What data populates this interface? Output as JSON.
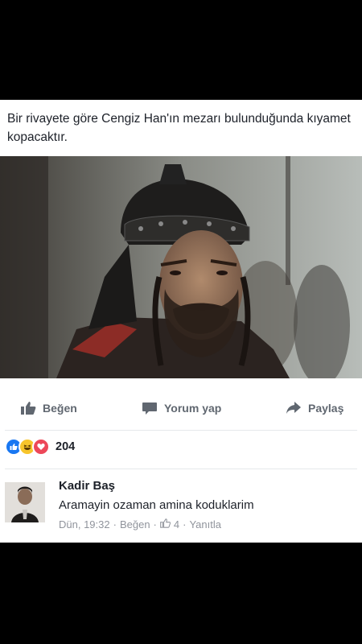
{
  "post": {
    "text": "Bir rivayete göre Cengiz Han'ın mezarı bulunduğunda kıyamet kopacaktır."
  },
  "actions": {
    "like_label": "Beğen",
    "comment_label": "Yorum yap",
    "share_label": "Paylaş"
  },
  "reactions": {
    "icons": [
      "like-icon",
      "haha-icon",
      "love-icon"
    ],
    "count": "204"
  },
  "comment": {
    "author": "Kadir Baş",
    "text": "Aramayin ozaman amina koduklarim",
    "time": "Dün, 19:32",
    "like_label": "Beğen",
    "like_count": "4",
    "reply_label": "Yanıtla",
    "separator": "·"
  },
  "colors": {
    "text": "#1d2129",
    "muted": "#606770",
    "meta": "#90949c",
    "like_blue": "#1877f2",
    "love_red": "#ed4859",
    "haha_yellow": "#f7c52b"
  }
}
